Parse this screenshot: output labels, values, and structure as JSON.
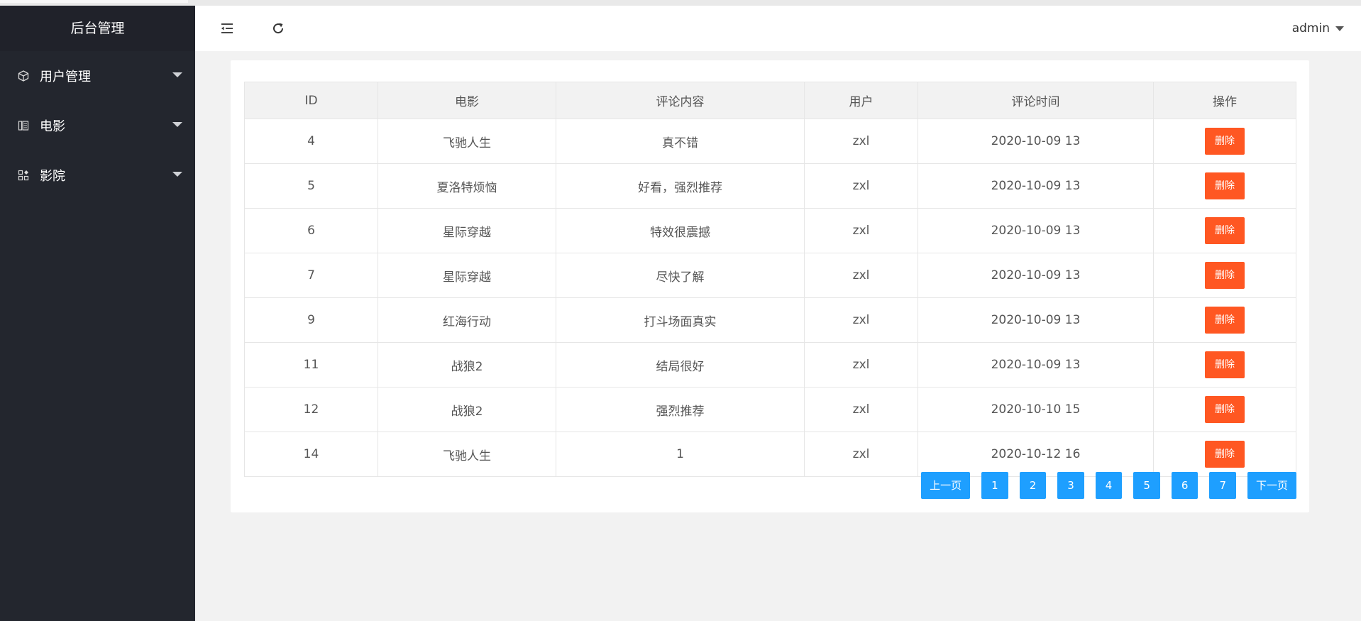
{
  "sidebar": {
    "brand": "后台管理",
    "items": [
      {
        "label": "用户管理",
        "icon": "cube-icon"
      },
      {
        "label": "电影",
        "icon": "film-icon"
      },
      {
        "label": "影院",
        "icon": "apps-icon"
      }
    ]
  },
  "header": {
    "user": "admin",
    "icons": [
      "menu-shrink-icon",
      "refresh-icon"
    ]
  },
  "table": {
    "headers": [
      "ID",
      "电影",
      "评论内容",
      "用户",
      "评论时间",
      "操作"
    ],
    "rows": [
      {
        "id": "4",
        "movie": "飞驰人生",
        "comment": "真不错",
        "user": "zxl",
        "time": "2020-10-09 13",
        "action": "删除"
      },
      {
        "id": "5",
        "movie": "夏洛特烦恼",
        "comment": "好看，强烈推荐",
        "user": "zxl",
        "time": "2020-10-09 13",
        "action": "删除"
      },
      {
        "id": "6",
        "movie": "星际穿越",
        "comment": "特效很震撼",
        "user": "zxl",
        "time": "2020-10-09 13",
        "action": "删除"
      },
      {
        "id": "7",
        "movie": "星际穿越",
        "comment": "尽快了解",
        "user": "zxl",
        "time": "2020-10-09 13",
        "action": "删除"
      },
      {
        "id": "9",
        "movie": "红海行动",
        "comment": "打斗场面真实",
        "user": "zxl",
        "time": "2020-10-09 13",
        "action": "删除"
      },
      {
        "id": "11",
        "movie": "战狼2",
        "comment": "结局很好",
        "user": "zxl",
        "time": "2020-10-09 13",
        "action": "删除"
      },
      {
        "id": "12",
        "movie": "战狼2",
        "comment": "强烈推荐",
        "user": "zxl",
        "time": "2020-10-10 15",
        "action": "删除"
      },
      {
        "id": "14",
        "movie": "飞驰人生",
        "comment": "1",
        "user": "zxl",
        "time": "2020-10-12 16",
        "action": "删除"
      }
    ]
  },
  "pagination": {
    "prev": "上一页",
    "pages": [
      "1",
      "2",
      "3",
      "4",
      "5",
      "6",
      "7"
    ],
    "next": "下一页"
  },
  "colors": {
    "sidebar_bg": "#23262e",
    "delete_button": "#ff5722",
    "pager_button": "#1e9fff"
  }
}
